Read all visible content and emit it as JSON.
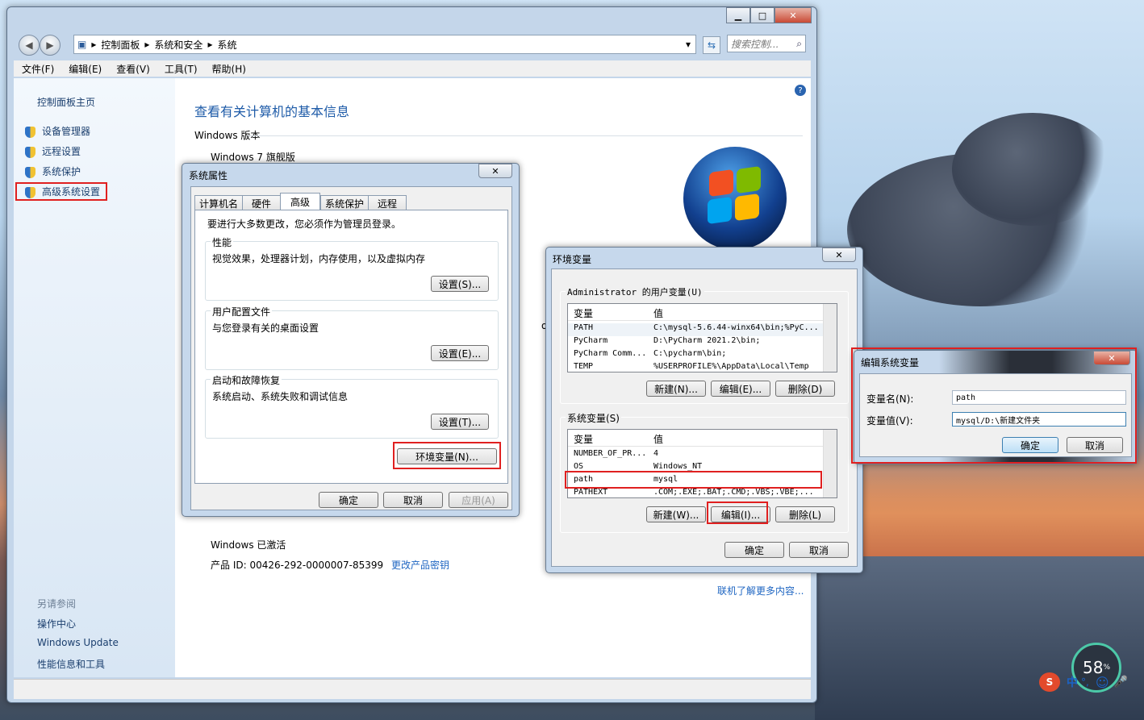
{
  "explorer": {
    "breadcrumb": [
      "控制面板",
      "系统和安全",
      "系统"
    ],
    "search_placeholder": "搜索控制...",
    "menu": [
      "文件(F)",
      "编辑(E)",
      "查看(V)",
      "工具(T)",
      "帮助(H)"
    ],
    "left": {
      "home": "控制面板主页",
      "items": [
        "设备管理器",
        "远程设置",
        "系统保护",
        "高级系统设置"
      ],
      "see_also_title": "另请参阅",
      "see_also": [
        "操作中心",
        "Windows Update",
        "性能信息和工具"
      ]
    },
    "main": {
      "heading": "查看有关计算机的基本信息",
      "edition_section": "Windows 版本",
      "edition": "Windows 7 旗舰版",
      "activated": "Windows 已激活",
      "product_id": "产品 ID: 00426-292-0000007-85399",
      "change_key": "更改产品密钥",
      "learn_more": "联机了解更多内容...",
      "partial_text": "ocesso"
    }
  },
  "sysprops": {
    "title": "系统属性",
    "tabs": [
      "计算机名",
      "硬件",
      "高级",
      "系统保护",
      "远程"
    ],
    "admin_note": "要进行大多数更改，您必须作为管理员登录。",
    "performance": {
      "title": "性能",
      "desc": "视觉效果，处理器计划，内存使用，以及虚拟内存",
      "button": "设置(S)..."
    },
    "profiles": {
      "title": "用户配置文件",
      "desc": "与您登录有关的桌面设置",
      "button": "设置(E)..."
    },
    "startup": {
      "title": "启动和故障恢复",
      "desc": "系统启动、系统失败和调试信息",
      "button": "设置(T)..."
    },
    "env_button": "环境变量(N)...",
    "ok": "确定",
    "cancel": "取消",
    "apply": "应用(A)"
  },
  "envvars": {
    "title": "环境变量",
    "user_section": "Administrator 的用户变量(U)",
    "col_var": "变量",
    "col_val": "值",
    "user_rows": [
      {
        "name": "PATH",
        "value": "C:\\mysql-5.6.44-winx64\\bin;%PyC..."
      },
      {
        "name": "PyCharm",
        "value": "D:\\PyCharm 2021.2\\bin;"
      },
      {
        "name": "PyCharm Comm...",
        "value": "C:\\pycharm\\bin;"
      },
      {
        "name": "TEMP",
        "value": "%USERPROFILE%\\AppData\\Local\\Temp"
      }
    ],
    "user_new": "新建(N)...",
    "user_edit": "编辑(E)...",
    "user_delete": "删除(D)",
    "sys_section": "系统变量(S)",
    "sys_rows": [
      {
        "name": "NUMBER_OF_PR...",
        "value": "4"
      },
      {
        "name": "OS",
        "value": "Windows_NT"
      },
      {
        "name": "path",
        "value": "mysql"
      },
      {
        "name": "PATHEXT",
        "value": ".COM;.EXE;.BAT;.CMD;.VBS;.VBE;..."
      }
    ],
    "sys_new": "新建(W)...",
    "sys_edit": "编辑(I)...",
    "sys_delete": "删除(L)",
    "ok": "确定",
    "cancel": "取消"
  },
  "editvar": {
    "title": "编辑系统变量",
    "name_label": "变量名(N):",
    "value_label": "变量值(V):",
    "name_value": "path",
    "value_value": "mysql/D:\\新建文件夹",
    "ok": "确定",
    "cancel": "取消"
  },
  "tray": {
    "percent": "58",
    "percent_unit": "%",
    "ime": "中",
    "ime_punct": "°,"
  }
}
